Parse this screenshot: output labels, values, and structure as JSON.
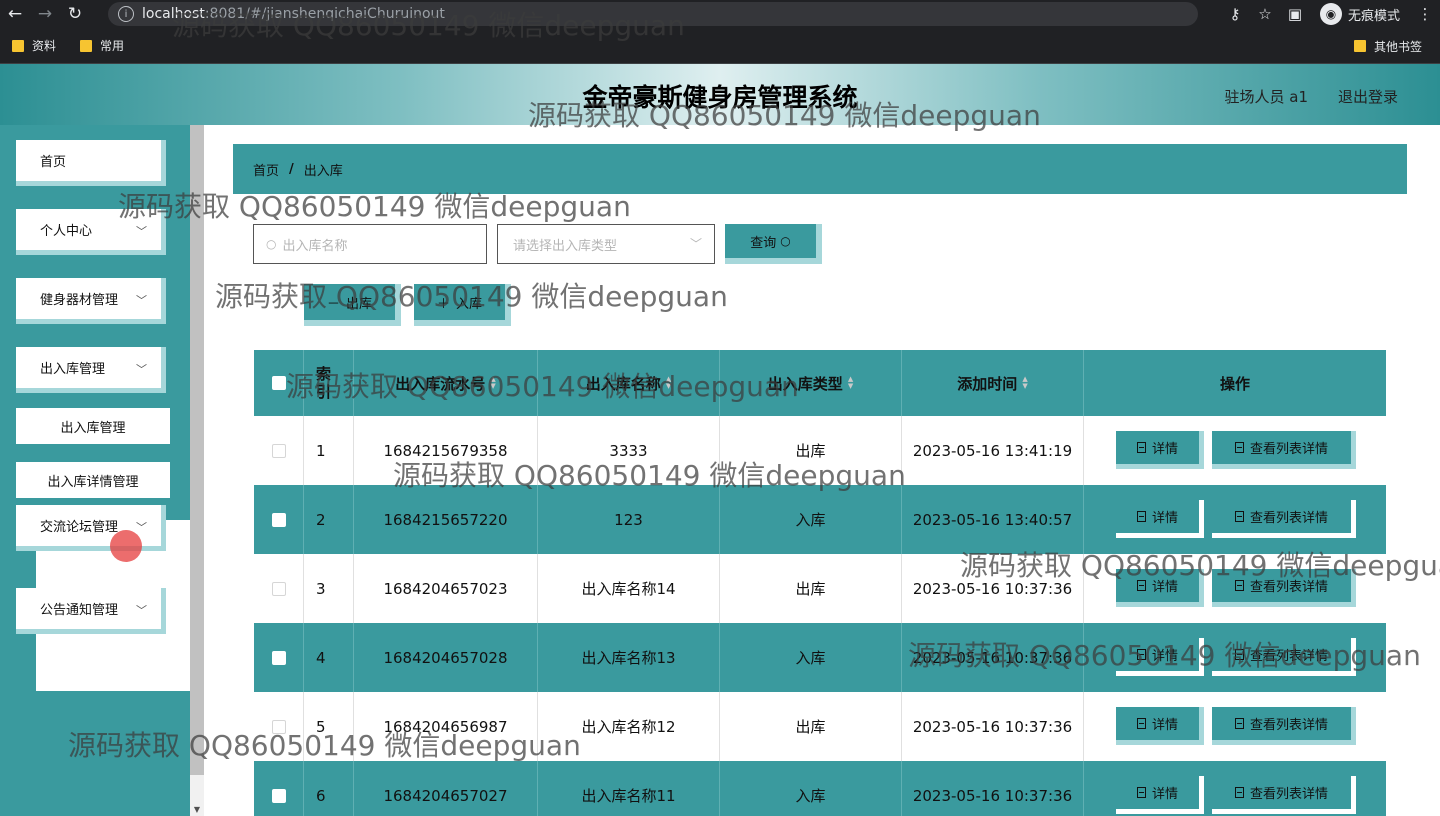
{
  "browser": {
    "url_host": "localhost",
    "url_path": ":8081/#/jianshenqichaiChuruinout",
    "incognito_label": "无痕模式",
    "bookmarks": [
      "资料",
      "常用"
    ],
    "other_bookmarks": "其他书签"
  },
  "header": {
    "title": "金帝豪斯健身房管理系统",
    "user": "驻场人员 a1",
    "logout": "退出登录"
  },
  "sidebar": {
    "items": [
      {
        "label": "首页"
      },
      {
        "label": "个人中心"
      },
      {
        "label": "健身器材管理"
      },
      {
        "label": "出入库管理"
      },
      {
        "label": "交流论坛管理"
      },
      {
        "label": "公告通知管理"
      }
    ],
    "sub_items": [
      "出入库管理",
      "出入库详情管理"
    ]
  },
  "breadcrumb": {
    "home": "首页",
    "sep": "/",
    "current": "出入库"
  },
  "search": {
    "name_placeholder": "出入库名称",
    "type_placeholder": "请选择出入库类型",
    "query_label": "查询"
  },
  "actions": {
    "out_label": "出库",
    "in_label": "入库"
  },
  "table": {
    "headers": [
      "索引",
      "出入库流水号",
      "出入库名称",
      "出入库类型",
      "添加时间",
      "操作"
    ],
    "detail_label": "详情",
    "list_detail_label": "查看列表详情",
    "rows": [
      {
        "idx": "1",
        "serial": "1684215679358",
        "name": "3333",
        "type": "出库",
        "time": "2023-05-16 13:41:19"
      },
      {
        "idx": "2",
        "serial": "1684215657220",
        "name": "123",
        "type": "入库",
        "time": "2023-05-16 13:40:57"
      },
      {
        "idx": "3",
        "serial": "1684204657023",
        "name": "出入库名称14",
        "type": "出库",
        "time": "2023-05-16 10:37:36"
      },
      {
        "idx": "4",
        "serial": "1684204657028",
        "name": "出入库名称13",
        "type": "入库",
        "time": "2023-05-16 10:37:36"
      },
      {
        "idx": "5",
        "serial": "1684204656987",
        "name": "出入库名称12",
        "type": "出库",
        "time": "2023-05-16 10:37:36"
      },
      {
        "idx": "6",
        "serial": "1684204657027",
        "name": "出入库名称11",
        "type": "入库",
        "time": "2023-05-16 10:37:36"
      }
    ]
  },
  "watermark": "源码获取 QQ86050149 微信deepguan"
}
